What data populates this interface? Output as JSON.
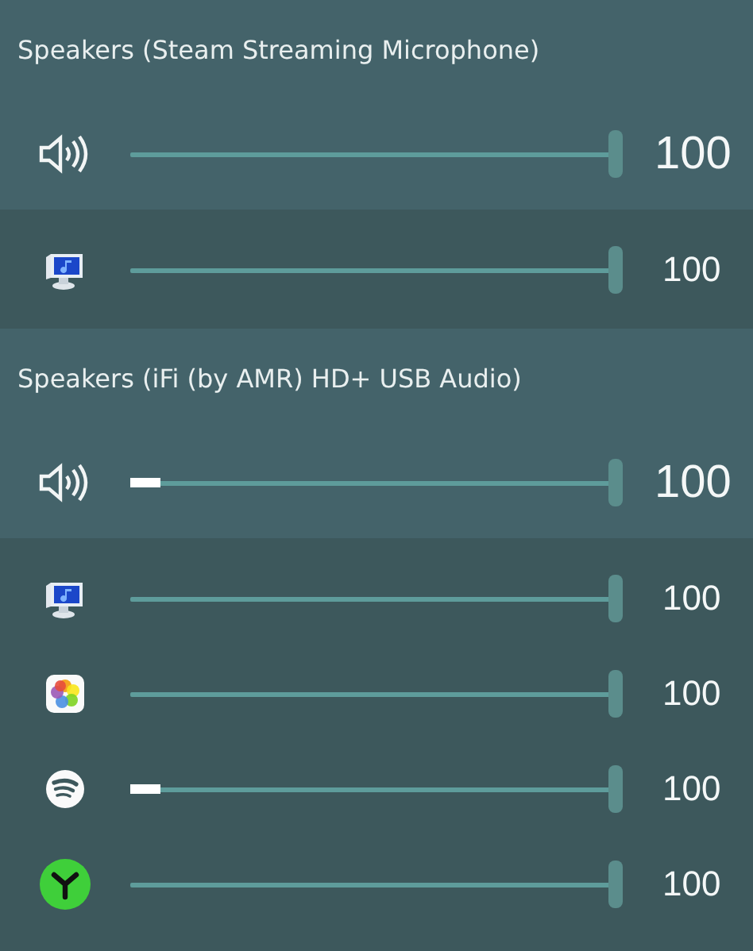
{
  "devices": [
    {
      "name": "Speakers (Steam Streaming Microphone)",
      "master": {
        "kind": "speaker",
        "level": 1,
        "reading": "100"
      },
      "apps": [
        {
          "kind": "monitor",
          "level": 1,
          "reading": "100"
        }
      ]
    },
    {
      "name": "Speakers (iFi (by AMR) HD+ USB Audio)",
      "master": {
        "kind": "speaker",
        "level": 1,
        "reading": "100",
        "meter": {
          "level": 0.06
        }
      },
      "apps": [
        {
          "kind": "monitor",
          "level": 1,
          "reading": "100"
        },
        {
          "kind": "flower",
          "level": 1,
          "reading": "100"
        },
        {
          "kind": "stripes",
          "level": 1,
          "reading": "100",
          "meter": {
            "level": 0.06
          }
        },
        {
          "kind": "yshape",
          "level": 1,
          "reading": "100"
        }
      ]
    }
  ]
}
